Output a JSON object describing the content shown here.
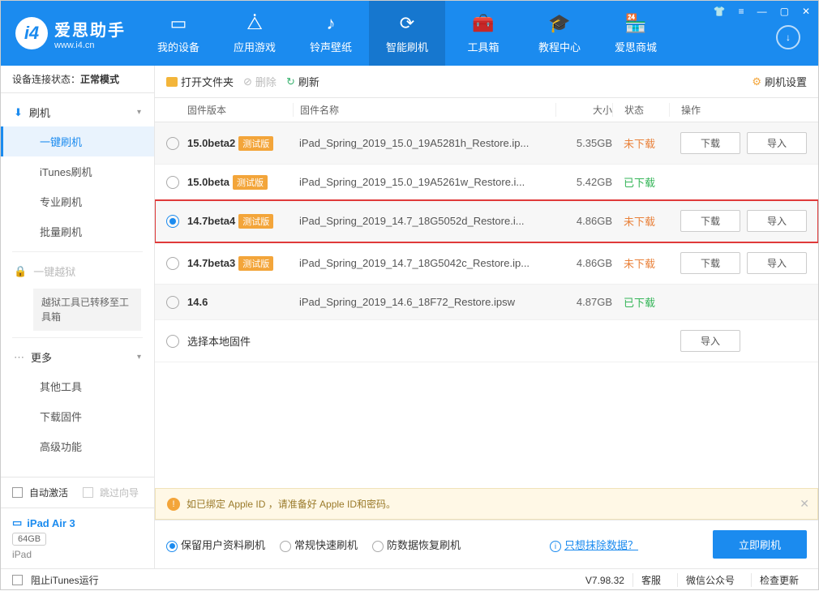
{
  "app": {
    "title": "爱思助手",
    "subtitle": "www.i4.cn"
  },
  "nav": {
    "items": [
      {
        "label": "我的设备"
      },
      {
        "label": "应用游戏"
      },
      {
        "label": "铃声壁纸"
      },
      {
        "label": "智能刷机"
      },
      {
        "label": "工具箱"
      },
      {
        "label": "教程中心"
      },
      {
        "label": "爱思商城"
      }
    ]
  },
  "connection": {
    "label": "设备连接状态：",
    "value": "正常模式"
  },
  "sidebar": {
    "flash": {
      "head": "刷机",
      "items": [
        "一键刷机",
        "iTunes刷机",
        "专业刷机",
        "批量刷机"
      ]
    },
    "jailbreak": {
      "head": "一键越狱",
      "sub": "越狱工具已转移至工具箱"
    },
    "more": {
      "head": "更多",
      "items": [
        "其他工具",
        "下载固件",
        "高级功能"
      ]
    },
    "auto_activate": "自动激活",
    "skip_guide": "跳过向导",
    "device": {
      "name": "iPad Air 3",
      "storage": "64GB",
      "type": "iPad"
    },
    "block_itunes": "阻止iTunes运行"
  },
  "toolbar": {
    "open": "打开文件夹",
    "delete": "删除",
    "refresh": "刷新",
    "settings": "刷机设置"
  },
  "table": {
    "head": {
      "ver": "固件版本",
      "name": "固件名称",
      "size": "大小",
      "status": "状态",
      "ops": "操作"
    },
    "badge": "测试版",
    "download": "下载",
    "import": "导入",
    "local": "选择本地固件",
    "rows": [
      {
        "ver": "15.0beta2",
        "badge": true,
        "name": "iPad_Spring_2019_15.0_19A5281h_Restore.ip...",
        "size": "5.35GB",
        "status": "未下载",
        "status_cls": "red",
        "dl": true,
        "imp": true,
        "gray": true
      },
      {
        "ver": "15.0beta",
        "badge": true,
        "name": "iPad_Spring_2019_15.0_19A5261w_Restore.i...",
        "size": "5.42GB",
        "status": "已下载",
        "status_cls": "green",
        "dl": false,
        "imp": false
      },
      {
        "ver": "14.7beta4",
        "badge": true,
        "name": "iPad_Spring_2019_14.7_18G5052d_Restore.i...",
        "size": "4.86GB",
        "status": "未下载",
        "status_cls": "red",
        "dl": true,
        "imp": true,
        "gray": true,
        "checked": true,
        "highlight": true
      },
      {
        "ver": "14.7beta3",
        "badge": true,
        "name": "iPad_Spring_2019_14.7_18G5042c_Restore.ip...",
        "size": "4.86GB",
        "status": "未下载",
        "status_cls": "red",
        "dl": true,
        "imp": true
      },
      {
        "ver": "14.6",
        "badge": false,
        "name": "iPad_Spring_2019_14.6_18F72_Restore.ipsw",
        "size": "4.87GB",
        "status": "已下载",
        "status_cls": "green",
        "dl": false,
        "imp": false,
        "gray": true
      }
    ]
  },
  "alert": "如已绑定 Apple ID ，请准备好 Apple ID和密码。",
  "options": {
    "keep": "保留用户资料刷机",
    "normal": "常规快速刷机",
    "recover": "防数据恢复刷机",
    "erase_link": "只想抹除数据？",
    "flash": "立即刷机"
  },
  "footer": {
    "version": "V7.98.32",
    "service": "客服",
    "wechat": "微信公众号",
    "check": "检查更新"
  }
}
